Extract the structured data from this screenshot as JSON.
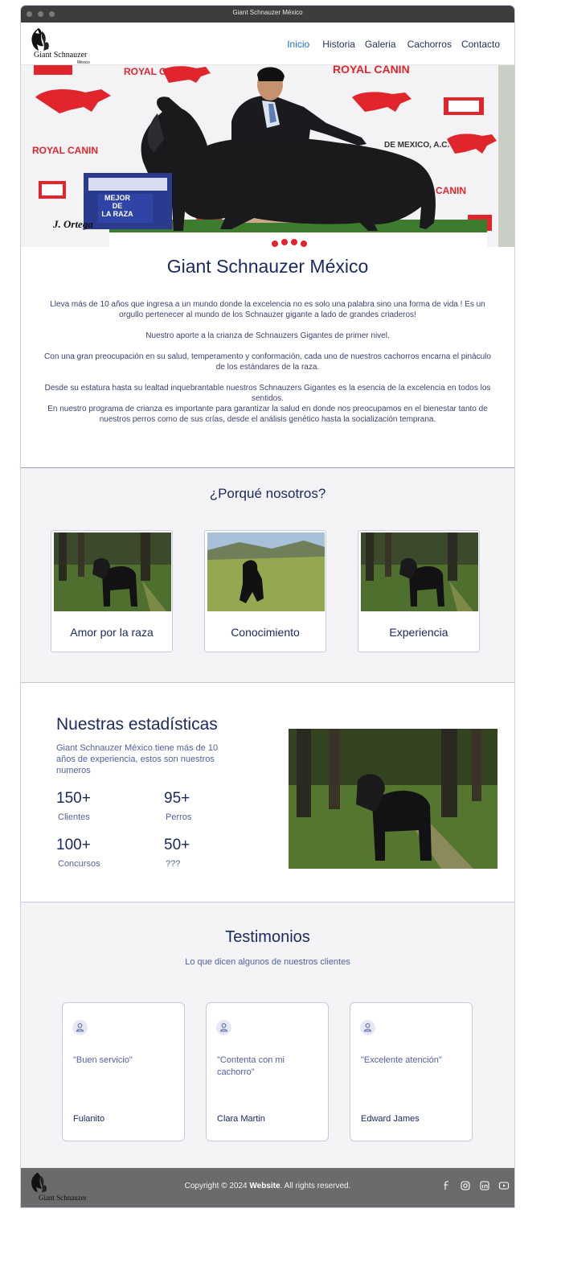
{
  "window": {
    "title": "Giant Schnauzer México"
  },
  "brand": {
    "logo_text": "Giant Schnauzer",
    "logo_sub": "México"
  },
  "nav": {
    "items": [
      {
        "label": "Inicio",
        "active": true
      },
      {
        "label": "Historia",
        "active": false
      },
      {
        "label": "Galeria",
        "active": false
      },
      {
        "label": "Cachorros",
        "active": false
      },
      {
        "label": "Contacto",
        "active": false
      }
    ]
  },
  "hero": {
    "banner_brand": "ROYAL CANIN",
    "award_line1": "MEJOR",
    "award_line2": "DE",
    "award_line3": "LA RAZA",
    "photographer": "J. Ortega",
    "backdrop_text": "DE MEXICO, A.C."
  },
  "about": {
    "title": "Giant Schnauzer México",
    "p1": "Lleva más de 10 años que ingresa  a un mundo donde la excelencia no es solo una palabra sino una forma de vida ! Es un orgullo pertenecer al mundo  de los Schnauzer gigante a lado de grandes criaderos!",
    "p2": "Nuestro aporte a la crianza de Schnauzers Gigantes de primer nivel.",
    "p3": "Con una gran preocupación en  su salud, temperamento y  conformación, cada uno de nuestros cachorros encarna el pináculo de los estándares de la raza.",
    "p4": "Desde su  estatura hasta su lealtad inquebrantable nuestros Schnauzers Gigantes es la esencia de la excelencia en todos los sentidos.",
    "p5": "En nuestro programa de crianza es importante para garantizar la salud en donde nos preocupamos en el bienestar tanto de nuestros perros como de sus crías, desde el análisis genético hasta la socialización temprana."
  },
  "why": {
    "title": "¿Porqué nosotros?",
    "cards": [
      {
        "label": "Amor por la raza"
      },
      {
        "label": "Conocimiento"
      },
      {
        "label": "Experiencia"
      }
    ]
  },
  "stats": {
    "title": "Nuestras estadísticas",
    "description": "Giant Schnauzer México tiene más de 10 años de experiencia, estos son nuestros numeros",
    "items": [
      {
        "value": "150+",
        "caption": "Clientes"
      },
      {
        "value": "95+",
        "caption": "Perros"
      },
      {
        "value": "100+",
        "caption": "Concursos"
      },
      {
        "value": "50+",
        "caption": "???"
      }
    ]
  },
  "testimonials": {
    "title": "Testimonios",
    "subtitle": "Lo que dicen algunos de nuestros clientes",
    "items": [
      {
        "quote": "\"Buen servicio\"",
        "name": "Fulanito"
      },
      {
        "quote": "\"Contenta con mi cachorro\"",
        "name": "Clara Martin"
      },
      {
        "quote": "\"Excelente atención\"",
        "name": "Edward James"
      }
    ]
  },
  "footer": {
    "copy_prefix": "Copyright © 2024 ",
    "copy_site": "Website",
    "copy_suffix": ". All rights reserved.",
    "social": [
      "facebook-icon",
      "instagram-icon",
      "linkedin-icon",
      "youtube-icon"
    ]
  },
  "colors": {
    "accent": "#1a6ed8",
    "heading": "#1c2a62",
    "muted": "#5161a0",
    "footer": "#6b6b6b",
    "section_bg": "#f4f4f6"
  }
}
